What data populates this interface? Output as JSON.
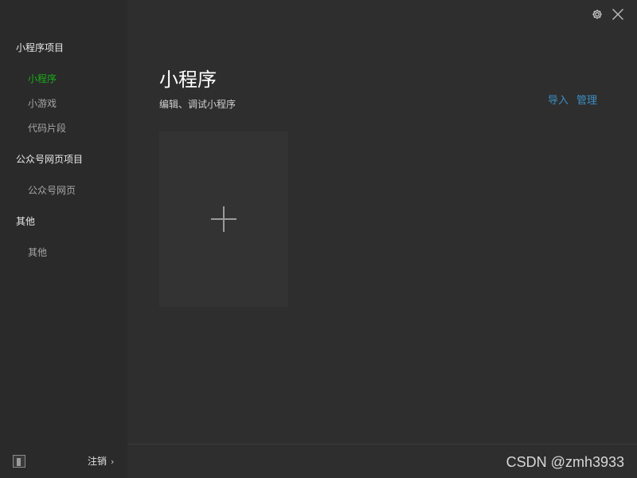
{
  "sidebar": {
    "groups": [
      {
        "title": "小程序项目",
        "items": [
          {
            "label": "小程序",
            "active": true
          },
          {
            "label": "小游戏",
            "active": false
          },
          {
            "label": "代码片段",
            "active": false
          }
        ]
      },
      {
        "title": "公众号网页项目",
        "items": [
          {
            "label": "公众号网页",
            "active": false
          }
        ]
      },
      {
        "title": "其他",
        "items": [
          {
            "label": "其他",
            "active": false
          }
        ]
      }
    ],
    "footer": {
      "logout_label": "注销",
      "logout_chevron": "›",
      "avatar_icon": "user-avatar-icon"
    }
  },
  "main": {
    "title": "小程序",
    "subtitle": "编辑、调试小程序",
    "actions": {
      "import_label": "导入",
      "manage_label": "管理"
    },
    "new_project_icon": "plus-icon"
  },
  "topbar": {
    "settings_icon": "gear-icon",
    "close_icon": "close-icon"
  },
  "watermark": "CSDN @zmh3933",
  "colors": {
    "active": "#1aad19",
    "link": "#3c8fc4",
    "sidebar_bg": "#2a2a2a",
    "main_bg": "#2e2e2e"
  }
}
